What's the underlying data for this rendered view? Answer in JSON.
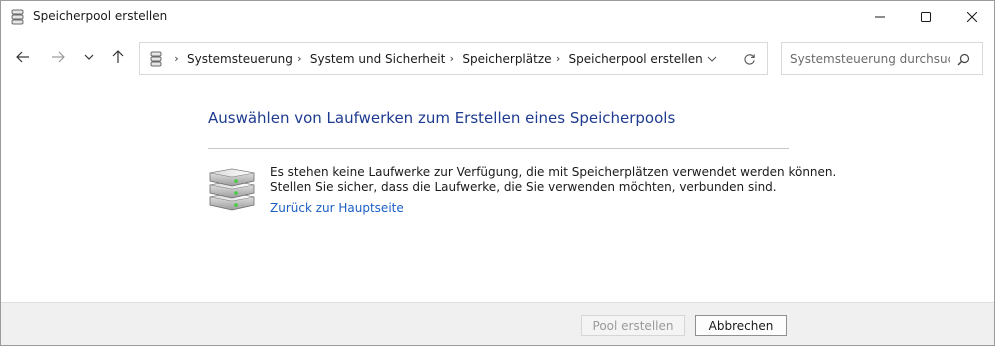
{
  "window": {
    "title": "Speicherpool erstellen",
    "controls": {
      "minimize": "minimize-icon",
      "maximize": "maximize-icon",
      "close": "close-icon"
    }
  },
  "navigation": {
    "back_icon": "arrow-left-icon",
    "forward_icon": "arrow-right-icon",
    "recent_icon": "chevron-down-icon",
    "up_icon": "arrow-up-icon"
  },
  "address_bar": {
    "icon": "storage-spaces-icon",
    "breadcrumbs": [
      "Systemsteuerung",
      "System und Sicherheit",
      "Speicherplätze",
      "Speicherpool erstellen"
    ]
  },
  "search": {
    "placeholder": "Systemsteuerung durchsuc...",
    "value": ""
  },
  "main": {
    "heading": "Auswählen von Laufwerken zum Erstellen eines Speicherpools",
    "message_line1": "Es stehen keine Laufwerke zur Verfügung, die mit Speicherplätzen verwendet werden können.",
    "message_line2": "Stellen Sie sicher, dass die Laufwerke, die Sie verwenden möchten, verbunden sind.",
    "back_link": "Zurück zur Hauptseite",
    "image_icon": "drives-stack-icon"
  },
  "footer": {
    "create_pool_label": "Pool erstellen",
    "create_pool_enabled": false,
    "cancel_label": "Abbrechen"
  },
  "colors": {
    "heading": "#1e3b8f",
    "link": "#1b5fc5",
    "footer_bg": "#f0f0f0",
    "disabled_text": "#9a9a9a"
  }
}
